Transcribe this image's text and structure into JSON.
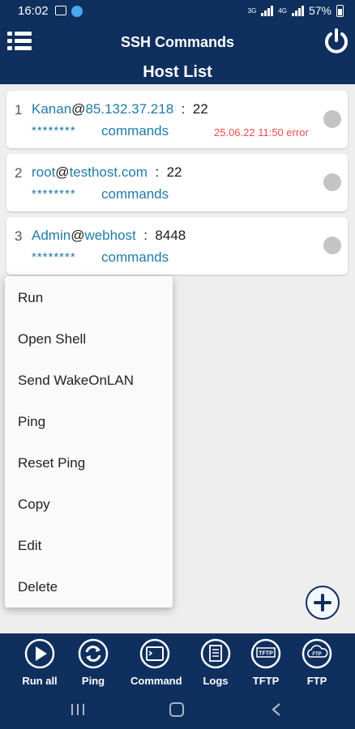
{
  "status_bar": {
    "time": "16:02",
    "battery": "57%",
    "network_left": "3G",
    "network_right": "4G"
  },
  "app_bar": {
    "title": "SSH Commands",
    "subtitle": "Host List"
  },
  "hosts": [
    {
      "index": "1",
      "user": "Kanan",
      "at": "@",
      "host": "85.132.37.218",
      "sep": ":",
      "port": "22",
      "password_mask": "********",
      "commands_label": "commands",
      "status": "25.06.22 11:50 error"
    },
    {
      "index": "2",
      "user": "root",
      "at": "@",
      "host": "testhost.com",
      "sep": ":",
      "port": "22",
      "password_mask": "********",
      "commands_label": "commands",
      "status": ""
    },
    {
      "index": "3",
      "user": "Admin",
      "at": "@",
      "host": "webhost",
      "sep": ":",
      "port": "8448",
      "password_mask": "********",
      "commands_label": "commands",
      "status": ""
    }
  ],
  "context_menu": {
    "items": [
      {
        "label": "Run"
      },
      {
        "label": "Open Shell"
      },
      {
        "label": "Send WakeOnLAN"
      },
      {
        "label": "Ping"
      },
      {
        "label": "Reset Ping"
      },
      {
        "label": "Copy"
      },
      {
        "label": "Edit"
      },
      {
        "label": "Delete"
      }
    ]
  },
  "bottom_bar": {
    "items": [
      {
        "label": "Run all",
        "icon": "play-icon"
      },
      {
        "label": "Ping",
        "icon": "refresh-icon"
      },
      {
        "label": "Command",
        "icon": "terminal-icon"
      },
      {
        "label": "Logs",
        "icon": "logs-icon"
      },
      {
        "label": "TFTP",
        "icon": "tftp-icon",
        "icon_text": "TFTP"
      },
      {
        "label": "FTP",
        "icon": "ftp-icon",
        "icon_text": "FTP"
      }
    ]
  },
  "colors": {
    "primary": "#0f2f5e",
    "link": "#1f7ba8",
    "error": "#e84d4d",
    "background": "#eeeeee"
  }
}
